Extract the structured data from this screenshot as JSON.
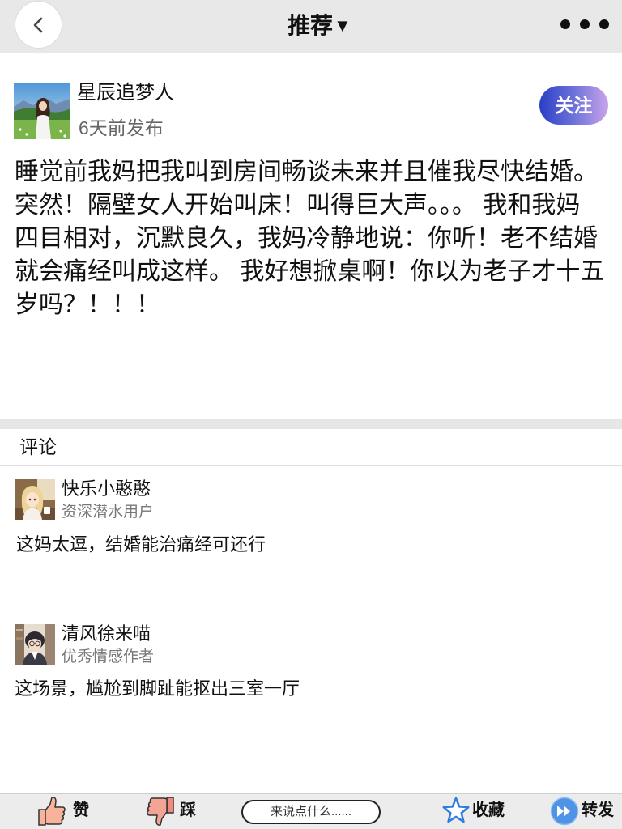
{
  "header": {
    "back_icon": "chevron-left-icon",
    "title": "推荐",
    "title_caret": "▼",
    "more_icon": "more-dots-icon"
  },
  "post": {
    "author": "星辰追梦人",
    "time": "6天前发布",
    "follow_label": "关注",
    "lines": [
      "睡觉前我妈把我叫到房间畅谈未来并且催我尽快结婚。",
      "突然！隔壁女人开始叫床！叫得巨大声。。。 我和我妈",
      "四目相对，沉默良久，我妈冷静地说：你听！老不结婚",
      "就会痛经叫成这样。 我好想掀桌啊！你以为老子才十五",
      "岁吗？！！！"
    ]
  },
  "comments": {
    "title": "评论",
    "items": [
      {
        "name": "快乐小憨憨",
        "badge": "资深潜水用户",
        "text": "这妈太逗，结婚能治痛经可还行"
      },
      {
        "name": "清风徐来喵",
        "badge": "优秀情感作者",
        "text": "这场景，尴尬到脚趾能抠出三室一厅"
      }
    ]
  },
  "bottom_bar": {
    "like_icon": "thumbs-up-icon",
    "like_label": "赞",
    "dislike_icon": "thumbs-down-icon",
    "dislike_label": "踩",
    "comment_placeholder": "来说点什么......",
    "favorite_icon": "star-icon",
    "favorite_label": "收藏",
    "share_icon": "forward-icon",
    "share_label": "转发"
  },
  "colors": {
    "topbar_bg": "#e8e8e8",
    "follow_gradient_start": "#2b3fc4",
    "follow_gradient_end": "#caa4ea",
    "star_blue": "#2f7de1",
    "share_blue": "#4f93e6",
    "like_peach": "#f7b39b",
    "dislike_red": "#f08a7a"
  }
}
